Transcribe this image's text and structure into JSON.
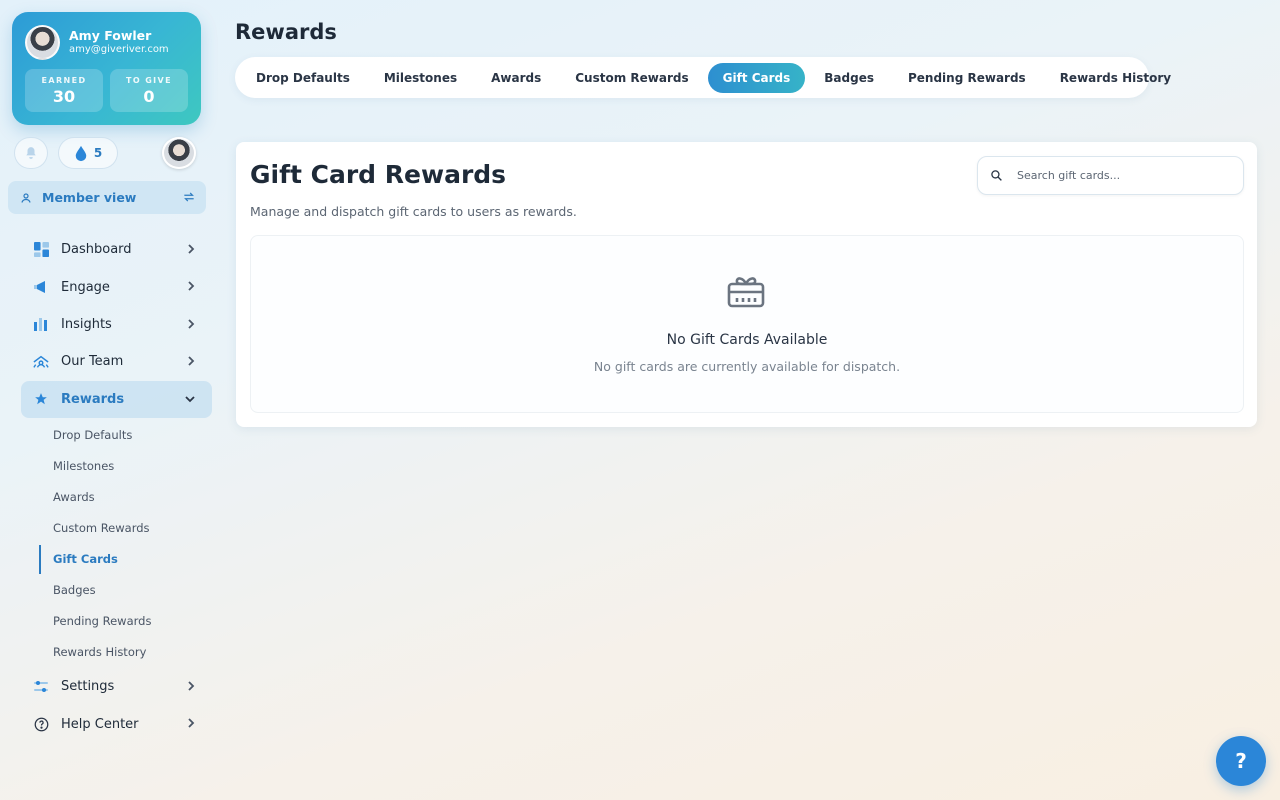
{
  "profile": {
    "name": "Amy Fowler",
    "email": "amy@giveriver.com",
    "earned_label": "EARNED",
    "earned_value": "30",
    "give_label": "TO GIVE",
    "give_value": "0"
  },
  "status": {
    "drops_count": "5"
  },
  "member_view": {
    "label": "Member view"
  },
  "nav": {
    "items": [
      {
        "label": "Dashboard",
        "icon": "dashboard-icon"
      },
      {
        "label": "Engage",
        "icon": "megaphone-icon"
      },
      {
        "label": "Insights",
        "icon": "bar-chart-icon"
      },
      {
        "label": "Our Team",
        "icon": "team-icon"
      },
      {
        "label": "Rewards",
        "icon": "star-icon"
      },
      {
        "label": "Settings",
        "icon": "sliders-icon"
      },
      {
        "label": "Help Center",
        "icon": "help-circle-icon"
      }
    ],
    "rewards_sub": [
      "Drop Defaults",
      "Milestones",
      "Awards",
      "Custom Rewards",
      "Gift Cards",
      "Badges",
      "Pending Rewards",
      "Rewards History"
    ]
  },
  "page": {
    "title": "Rewards"
  },
  "tabs": [
    "Drop Defaults",
    "Milestones",
    "Awards",
    "Custom Rewards",
    "Gift Cards",
    "Badges",
    "Pending Rewards",
    "Rewards History"
  ],
  "panel": {
    "title": "Gift Card Rewards",
    "subtitle": "Manage and dispatch gift cards to users as rewards.",
    "search_placeholder": "Search gift cards...",
    "empty_title": "No Gift Cards Available",
    "empty_subtitle": "No gift cards are currently available for dispatch."
  },
  "help_fab": {
    "label": "?"
  },
  "colors": {
    "accent": "#2b7bc0",
    "gradient_start": "#2d9bd6",
    "gradient_end": "#3ec8c0"
  }
}
